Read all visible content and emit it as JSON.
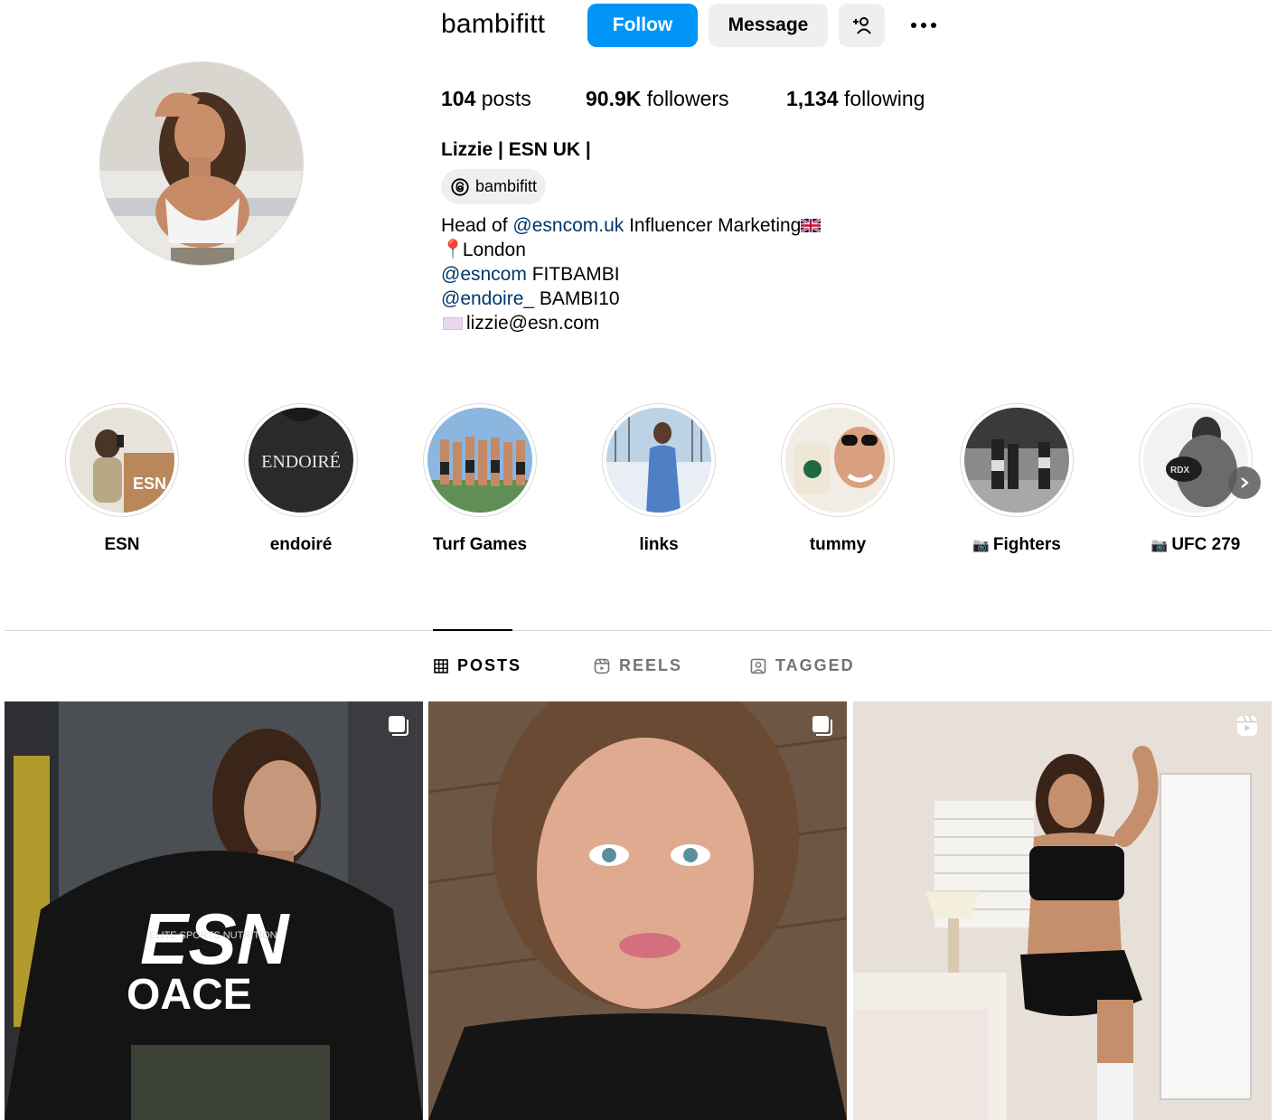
{
  "profile": {
    "username": "bambifitt",
    "follow_label": "Follow",
    "message_label": "Message",
    "stats": {
      "posts_count": "104",
      "posts_label": "posts",
      "followers_count": "90.9K",
      "followers_label": "followers",
      "following_count": "1,134",
      "following_label": "following"
    },
    "full_name": "Lizzie | ESN UK |",
    "threads_handle": "bambifitt",
    "bio": {
      "line1_prefix": "Head of ",
      "line1_mention": "@esncom.uk",
      "line1_suffix": " Influencer Marketing",
      "line2_emoji": "📍",
      "line2_text": "London",
      "line3_mention": "@esncom",
      "line3_text": " FITBAMBI",
      "line4_mention": "@endoire_",
      "line4_text": " BAMBI10",
      "line5_text": "lizzie@esn.com"
    }
  },
  "highlights": [
    {
      "label": "ESN",
      "camera": false
    },
    {
      "label": "endoiré",
      "camera": false,
      "cover_text": "ENDOIRÉ"
    },
    {
      "label": "Turf Games",
      "camera": false
    },
    {
      "label": "links",
      "camera": false
    },
    {
      "label": "tummy",
      "camera": false
    },
    {
      "label": "Fighters",
      "camera": true
    },
    {
      "label": "UFC 279",
      "camera": true
    }
  ],
  "tabs": [
    {
      "label": "POSTS",
      "active": true,
      "icon": "grid-icon"
    },
    {
      "label": "REELS",
      "active": false,
      "icon": "reels-icon"
    },
    {
      "label": "TAGGED",
      "active": false,
      "icon": "tagged-icon"
    }
  ],
  "posts": [
    {
      "type": "carousel",
      "shirt_brand": "ESN",
      "shirt_sub": "ELITE SPORTS NUTRITION",
      "shirt_text": "OACE"
    },
    {
      "type": "carousel"
    },
    {
      "type": "reel"
    }
  ],
  "colors": {
    "follow_blue": "#0095f6",
    "mention": "#00376b",
    "button_gray": "#efefef",
    "divider": "#dbdbdb"
  }
}
